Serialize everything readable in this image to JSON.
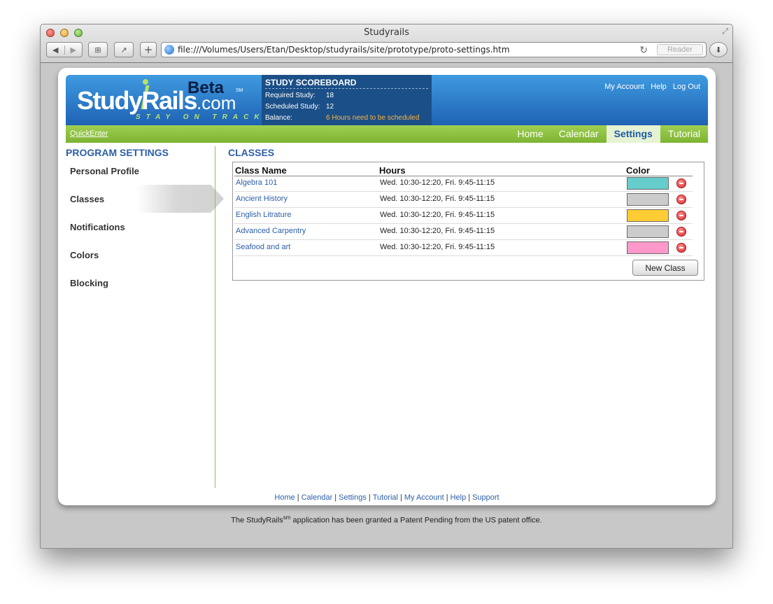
{
  "browser": {
    "title": "Studyrails",
    "url": "file:///Volumes/Users/Etan/Desktop/studyrails/site/prototype/proto-settings.htm",
    "reader_label": "Reader"
  },
  "logo": {
    "main": "StudyRails",
    "com": ".com",
    "beta": "Beta",
    "sm": "SM",
    "tagline": "STAY ON TRACK"
  },
  "scoreboard": {
    "title": "STUDY SCOREBOARD",
    "required_label": "Required Study:",
    "required_value": "18",
    "scheduled_label": "Scheduled Study:",
    "scheduled_value": "12",
    "balance_label": "Balance:",
    "balance_value": "6 Hours need to be scheduled"
  },
  "top_links": [
    "My Account",
    "Help",
    "Log Out"
  ],
  "navbar": {
    "quickenter": "QuickEnter",
    "tabs": [
      "Home",
      "Calendar",
      "Settings",
      "Tutorial"
    ],
    "active_tab": "Settings"
  },
  "sidebar": {
    "title": "PROGRAM SETTINGS",
    "items": [
      "Personal Profile",
      "Classes",
      "Notifications",
      "Colors",
      "Blocking"
    ],
    "active_item": "Classes"
  },
  "classes": {
    "title": "CLASSES",
    "headers": {
      "name": "Class Name",
      "hours": "Hours",
      "color": "Color"
    },
    "rows": [
      {
        "name": "Algebra 101",
        "hours": "Wed. 10:30-12:20, Fri. 9:45-11:15",
        "color": "#66cccc"
      },
      {
        "name": "Ancient History",
        "hours": "Wed. 10:30-12:20, Fri. 9:45-11:15",
        "color": "#cccccc"
      },
      {
        "name": "English Litrature",
        "hours": "Wed. 10:30-12:20, Fri. 9:45-11:15",
        "color": "#ffcc33"
      },
      {
        "name": "Advanced Carpentry",
        "hours": "Wed. 10:30-12:20, Fri. 9:45-11:15",
        "color": "#cccccc"
      },
      {
        "name": "Seafood and art",
        "hours": "Wed. 10:30-12:20, Fri. 9:45-11:15",
        "color": "#ff99cc"
      }
    ],
    "new_class_label": "New Class"
  },
  "footer": {
    "links": [
      "Home",
      "Calendar",
      "Settings",
      "Tutorial",
      "My Account",
      "Help",
      "Support"
    ],
    "patent_prefix": "The StudyRails",
    "patent_sup": "sm",
    "patent_suffix": " application has been granted a Patent Pending from the US patent office."
  }
}
